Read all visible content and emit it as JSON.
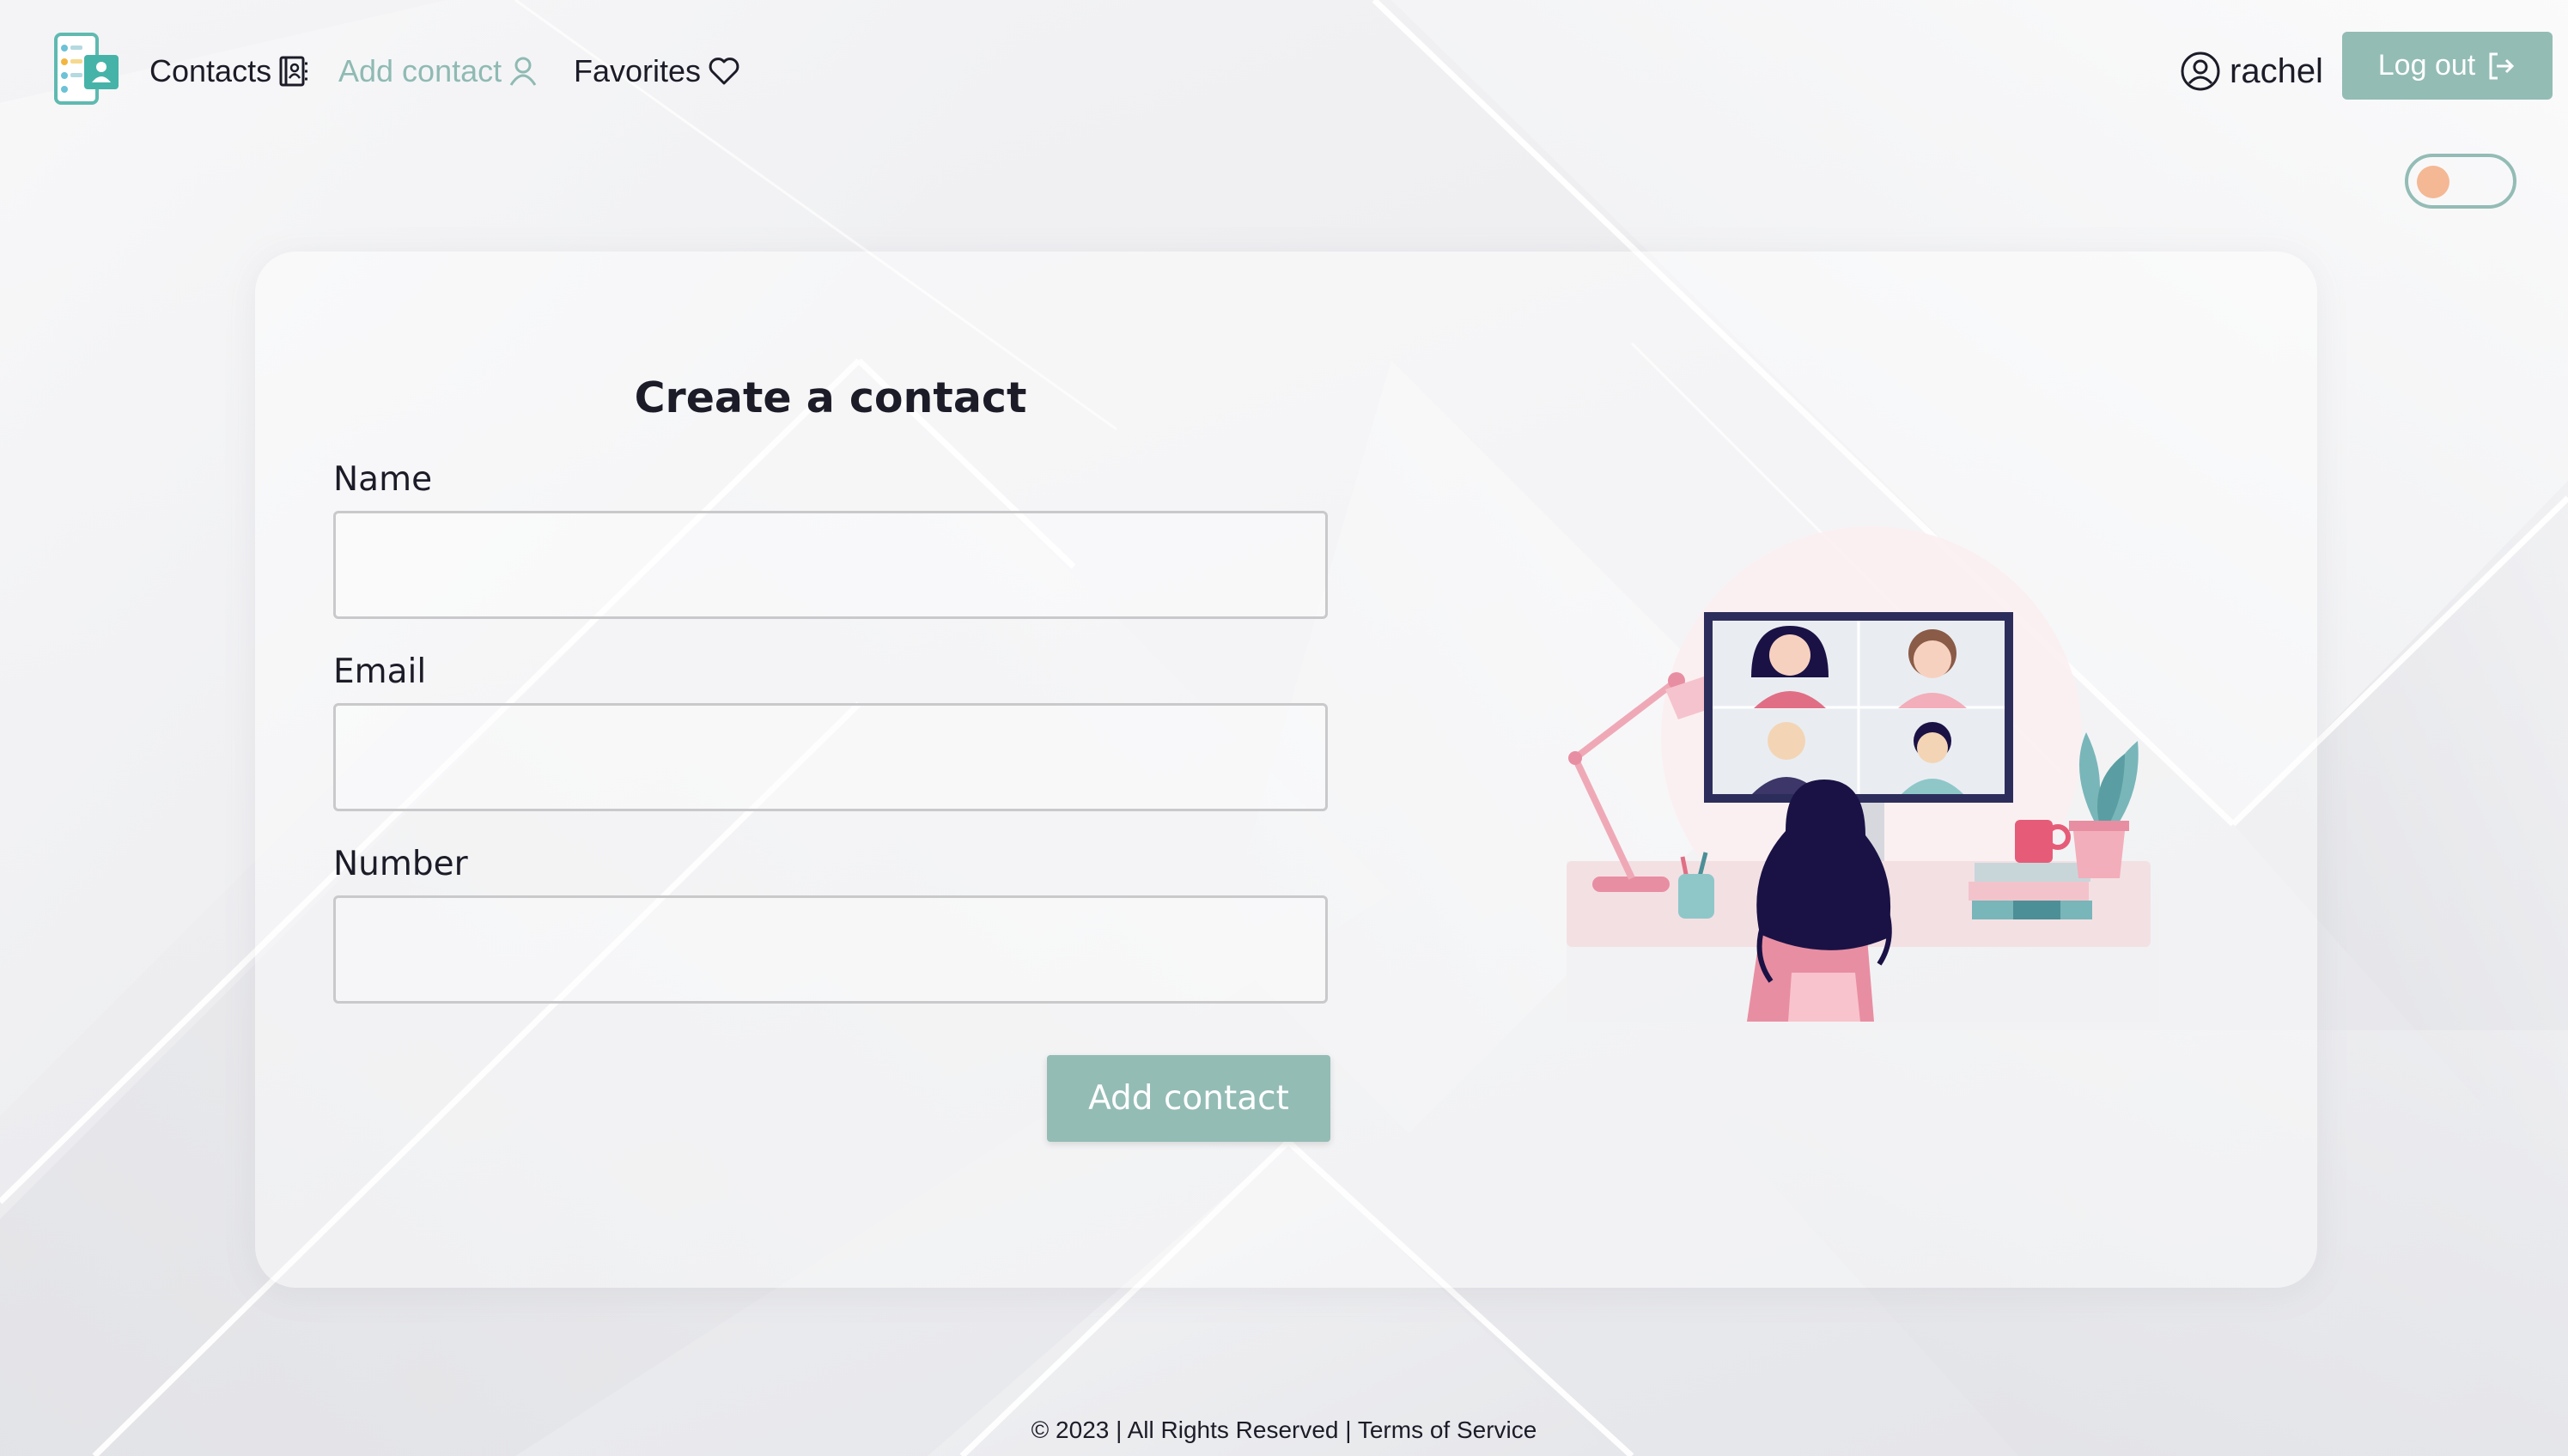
{
  "nav": {
    "contacts_label": "Contacts",
    "add_contact_label": "Add contact",
    "favorites_label": "Favorites",
    "active_item": "Add contact"
  },
  "user": {
    "name": "rachel",
    "logout_label": "Log out"
  },
  "theme_toggle": {
    "state": "off"
  },
  "form": {
    "title": "Create a contact",
    "name_label": "Name",
    "name_value": "",
    "email_label": "Email",
    "email_value": "",
    "number_label": "Number",
    "number_value": "",
    "submit_label": "Add contact"
  },
  "footer": {
    "copyright": "© 2023 | All Rights Reserved |",
    "terms_label": "Terms of Service"
  },
  "colors": {
    "accent": "#93bcb5",
    "accent_text": "#8fbab3",
    "text": "#1c1c28",
    "toggle_knob": "#f4b894",
    "background": "#ededf0"
  },
  "icons": {
    "logo": "contacts-app-logo",
    "contacts": "address-book-icon",
    "add_contact": "user-icon",
    "favorites": "heart-icon",
    "user": "user-circle-icon",
    "logout": "logout-icon"
  }
}
